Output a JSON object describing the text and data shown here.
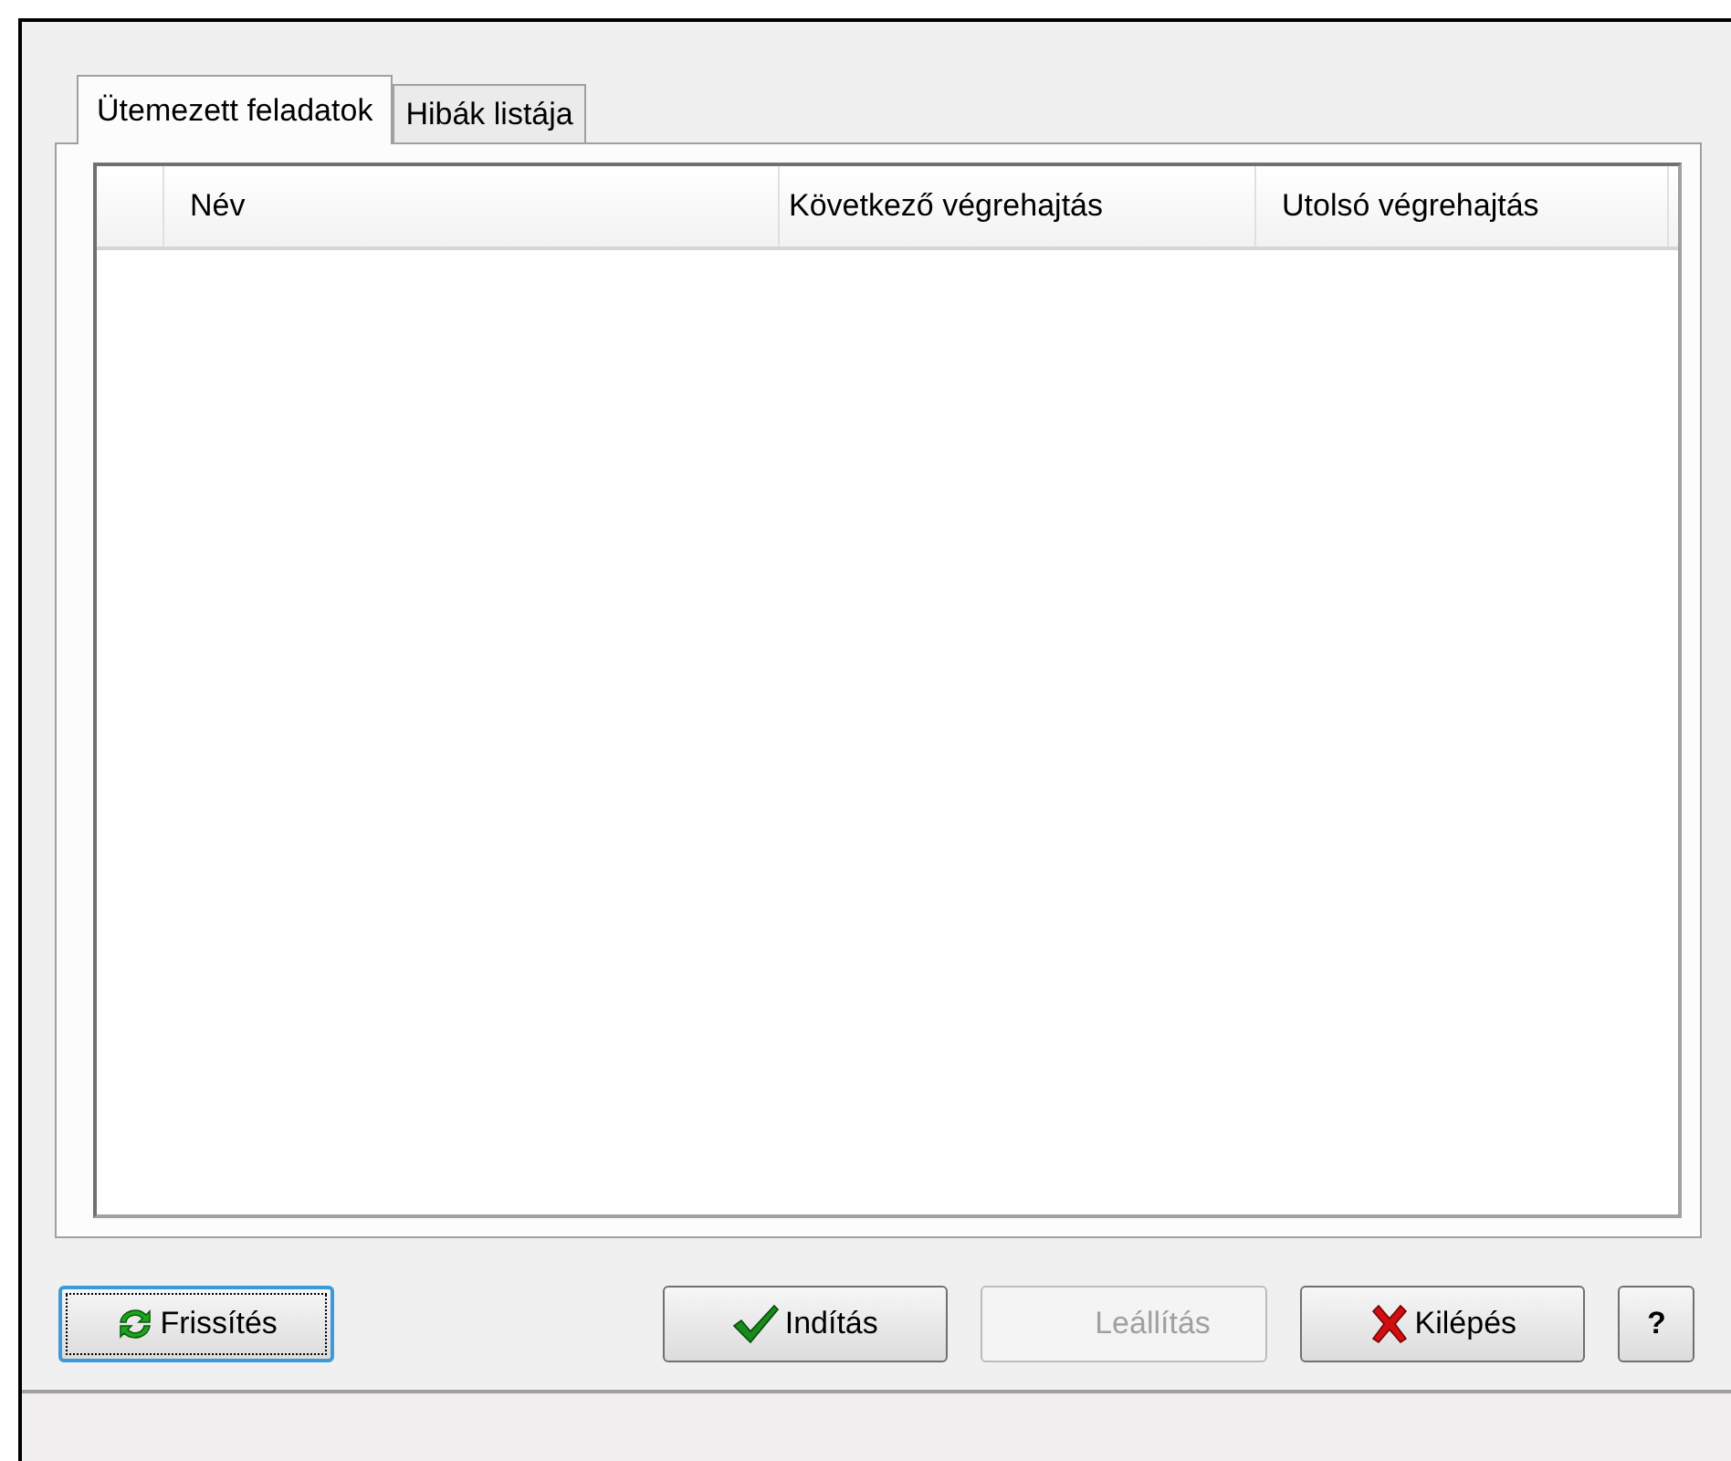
{
  "tabs": [
    {
      "label": "Ütemezett feladatok",
      "selected": true
    },
    {
      "label": "Hibák listája",
      "selected": false
    }
  ],
  "table": {
    "columns": [
      "Név",
      "Következő végrehajtás",
      "Utolsó végrehajtás"
    ]
  },
  "buttons": [
    {
      "label": "Frissítés",
      "kind": "refresh",
      "disabled": false,
      "focused": true
    },
    {
      "label": "Indítás",
      "kind": "check",
      "disabled": false,
      "focused": false
    },
    {
      "label": "Leállítás",
      "kind": "plain",
      "disabled": true,
      "focused": false
    },
    {
      "label": "Kilépés",
      "kind": "cross",
      "disabled": false,
      "focused": false
    },
    {
      "label": "?",
      "kind": "help",
      "disabled": false,
      "focused": false
    }
  ]
}
